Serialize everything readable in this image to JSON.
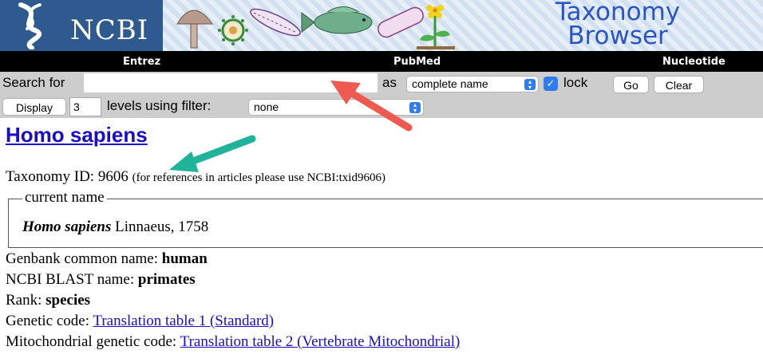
{
  "banner": {
    "logo_text": "NCBI",
    "title_line1": "Taxonomy",
    "title_line2": "Browser"
  },
  "nav": {
    "entrez": "Entrez",
    "pubmed": "PubMed",
    "nucleotide": "Nucleotide"
  },
  "search": {
    "label": "Search for",
    "value": "",
    "as_label": "as",
    "as_selected": "complete name",
    "lock_label": "lock",
    "lock_checked": true,
    "go_label": "Go",
    "clear_label": "Clear"
  },
  "display": {
    "button_label": "Display",
    "levels_value": "3",
    "levels_label": "levels using filter:",
    "filter_selected": "none"
  },
  "taxon": {
    "name": "Homo sapiens",
    "taxid_label": "Taxonomy ID:",
    "taxid_value": "9606",
    "taxid_note": "(for references in articles please use NCBI:txid9606)",
    "current_name_legend": "current name",
    "current_name_italic": "Homo sapiens",
    "current_name_authority": "Linnaeus, 1758",
    "genbank_label": "Genbank common name:",
    "genbank_value": "human",
    "blast_label": "NCBI BLAST name:",
    "blast_value": "primates",
    "rank_label": "Rank:",
    "rank_value": "species",
    "genetic_code_label": "Genetic code:",
    "genetic_code_link": "Translation table 1 (Standard)",
    "mito_code_label": "Mitochondrial genetic code:",
    "mito_code_link": "Translation table 2 (Vertebrate Mitochondrial)"
  },
  "colors": {
    "ncbi_blue": "#2f5a8f",
    "link_blue": "#1a0dcc",
    "control_blue": "#2f7bf1",
    "arrow_red": "#ee5a4f",
    "arrow_teal": "#1fb39a"
  }
}
